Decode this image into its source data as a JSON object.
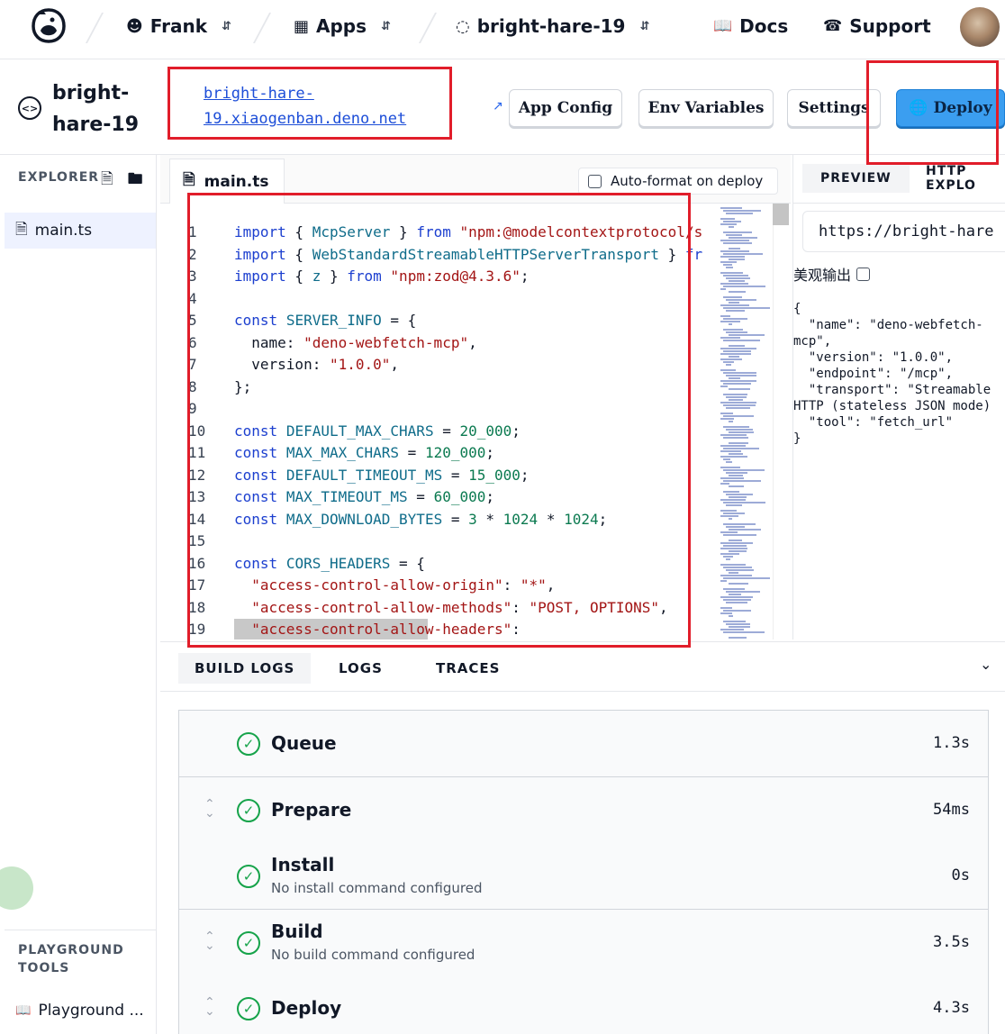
{
  "nav": {
    "org": "Frank",
    "apps": "Apps",
    "project": "bright-hare-19",
    "docs": "Docs",
    "support": "Support"
  },
  "header": {
    "project_name": "bright-hare-19",
    "url": "bright-hare-19.xiaogenban.deno.net",
    "buttons": {
      "app_config": "App Config",
      "env_variables": "Env Variables",
      "settings": "Settings",
      "deploy": "Deploy"
    }
  },
  "sidebar": {
    "explorer_title": "EXPLORER",
    "files": [
      "main.ts"
    ],
    "playground_title": "PLAYGROUND TOOLS",
    "playground_link": "Playground ..."
  },
  "editor": {
    "tab": "main.ts",
    "autoformat_label": "Auto-format on deploy",
    "autoformat_checked": false,
    "lines": [
      {
        "n": "1",
        "t": [
          [
            "kw",
            "import"
          ],
          [
            "pl",
            " { "
          ],
          [
            "id",
            "McpServer"
          ],
          [
            "pl",
            " } "
          ],
          [
            "kw",
            "from"
          ],
          [
            "pl",
            " "
          ],
          [
            "str",
            "\"npm:@modelcontextprotocol/s"
          ]
        ]
      },
      {
        "n": "2",
        "t": [
          [
            "kw",
            "import"
          ],
          [
            "pl",
            " { "
          ],
          [
            "id",
            "WebStandardStreamableHTTPServerTransport"
          ],
          [
            "pl",
            " } "
          ],
          [
            "kw",
            "fr"
          ]
        ]
      },
      {
        "n": "3",
        "t": [
          [
            "kw",
            "import"
          ],
          [
            "pl",
            " { "
          ],
          [
            "id",
            "z"
          ],
          [
            "pl",
            " } "
          ],
          [
            "kw",
            "from"
          ],
          [
            "pl",
            " "
          ],
          [
            "str",
            "\"npm:zod@4.3.6\""
          ],
          [
            "pl",
            ";"
          ]
        ]
      },
      {
        "n": "4",
        "t": []
      },
      {
        "n": "5",
        "t": [
          [
            "kw",
            "const"
          ],
          [
            "pl",
            " "
          ],
          [
            "id",
            "SERVER_INFO"
          ],
          [
            "pl",
            " = {"
          ]
        ]
      },
      {
        "n": "6",
        "t": [
          [
            "pl",
            "  name: "
          ],
          [
            "str",
            "\"deno-webfetch-mcp\""
          ],
          [
            "pl",
            ","
          ]
        ]
      },
      {
        "n": "7",
        "t": [
          [
            "pl",
            "  version: "
          ],
          [
            "str",
            "\"1.0.0\""
          ],
          [
            "pl",
            ","
          ]
        ]
      },
      {
        "n": "8",
        "t": [
          [
            "pl",
            "};"
          ]
        ]
      },
      {
        "n": "9",
        "t": []
      },
      {
        "n": "10",
        "t": [
          [
            "kw",
            "const"
          ],
          [
            "pl",
            " "
          ],
          [
            "id",
            "DEFAULT_MAX_CHARS"
          ],
          [
            "pl",
            " = "
          ],
          [
            "num",
            "20_000"
          ],
          [
            "pl",
            ";"
          ]
        ]
      },
      {
        "n": "11",
        "t": [
          [
            "kw",
            "const"
          ],
          [
            "pl",
            " "
          ],
          [
            "id",
            "MAX_MAX_CHARS"
          ],
          [
            "pl",
            " = "
          ],
          [
            "num",
            "120_000"
          ],
          [
            "pl",
            ";"
          ]
        ]
      },
      {
        "n": "12",
        "t": [
          [
            "kw",
            "const"
          ],
          [
            "pl",
            " "
          ],
          [
            "id",
            "DEFAULT_TIMEOUT_MS"
          ],
          [
            "pl",
            " = "
          ],
          [
            "num",
            "15_000"
          ],
          [
            "pl",
            ";"
          ]
        ]
      },
      {
        "n": "13",
        "t": [
          [
            "kw",
            "const"
          ],
          [
            "pl",
            " "
          ],
          [
            "id",
            "MAX_TIMEOUT_MS"
          ],
          [
            "pl",
            " = "
          ],
          [
            "num",
            "60_000"
          ],
          [
            "pl",
            ";"
          ]
        ]
      },
      {
        "n": "14",
        "t": [
          [
            "kw",
            "const"
          ],
          [
            "pl",
            " "
          ],
          [
            "id",
            "MAX_DOWNLOAD_BYTES"
          ],
          [
            "pl",
            " = "
          ],
          [
            "num",
            "3"
          ],
          [
            "pl",
            " * "
          ],
          [
            "num",
            "1024"
          ],
          [
            "pl",
            " * "
          ],
          [
            "num",
            "1024"
          ],
          [
            "pl",
            ";"
          ]
        ]
      },
      {
        "n": "15",
        "t": []
      },
      {
        "n": "16",
        "t": [
          [
            "kw",
            "const"
          ],
          [
            "pl",
            " "
          ],
          [
            "id",
            "CORS_HEADERS"
          ],
          [
            "pl",
            " = {"
          ]
        ]
      },
      {
        "n": "17",
        "t": [
          [
            "pl",
            "  "
          ],
          [
            "str",
            "\"access-control-allow-origin\""
          ],
          [
            "pl",
            ": "
          ],
          [
            "str",
            "\"*\""
          ],
          [
            "pl",
            ","
          ]
        ]
      },
      {
        "n": "18",
        "t": [
          [
            "pl",
            "  "
          ],
          [
            "str",
            "\"access-control-allow-methods\""
          ],
          [
            "pl",
            ": "
          ],
          [
            "str",
            "\"POST, OPTIONS\""
          ],
          [
            "pl",
            ","
          ]
        ]
      },
      {
        "n": "19",
        "t": [
          [
            "pl",
            "  "
          ],
          [
            "str",
            "\"access-control-allow-headers\""
          ],
          [
            "pl",
            ":"
          ]
        ]
      }
    ]
  },
  "preview": {
    "tabs": [
      "PREVIEW",
      "HTTP EXPLO"
    ],
    "url": "https://bright-hare",
    "pretty_label": "美观输出",
    "json_text": "{\n  \"name\": \"deno-webfetch-\nmcp\",\n  \"version\": \"1.0.0\",\n  \"endpoint\": \"/mcp\",\n  \"transport\": \"Streamable\nHTTP (stateless JSON mode)\n  \"tool\": \"fetch_url\"\n}"
  },
  "logs": {
    "tabs": [
      "BUILD LOGS",
      "LOGS",
      "TRACES"
    ],
    "steps": [
      {
        "name": "Queue",
        "sub": "",
        "duration": "1.3s",
        "expandable": false
      },
      {
        "name": "Prepare",
        "sub": "",
        "duration": "54ms",
        "expandable": true
      },
      {
        "name": "Install",
        "sub": "No install command configured",
        "duration": "0s",
        "expandable": false
      },
      {
        "name": "Build",
        "sub": "No build command configured",
        "duration": "3.5s",
        "expandable": true
      },
      {
        "name": "Deploy",
        "sub": "",
        "duration": "4.3s",
        "expandable": true
      }
    ]
  },
  "colors": {
    "accent": "#3b9ef0",
    "success": "#16a34a",
    "highlight_box": "#e11d2a"
  }
}
